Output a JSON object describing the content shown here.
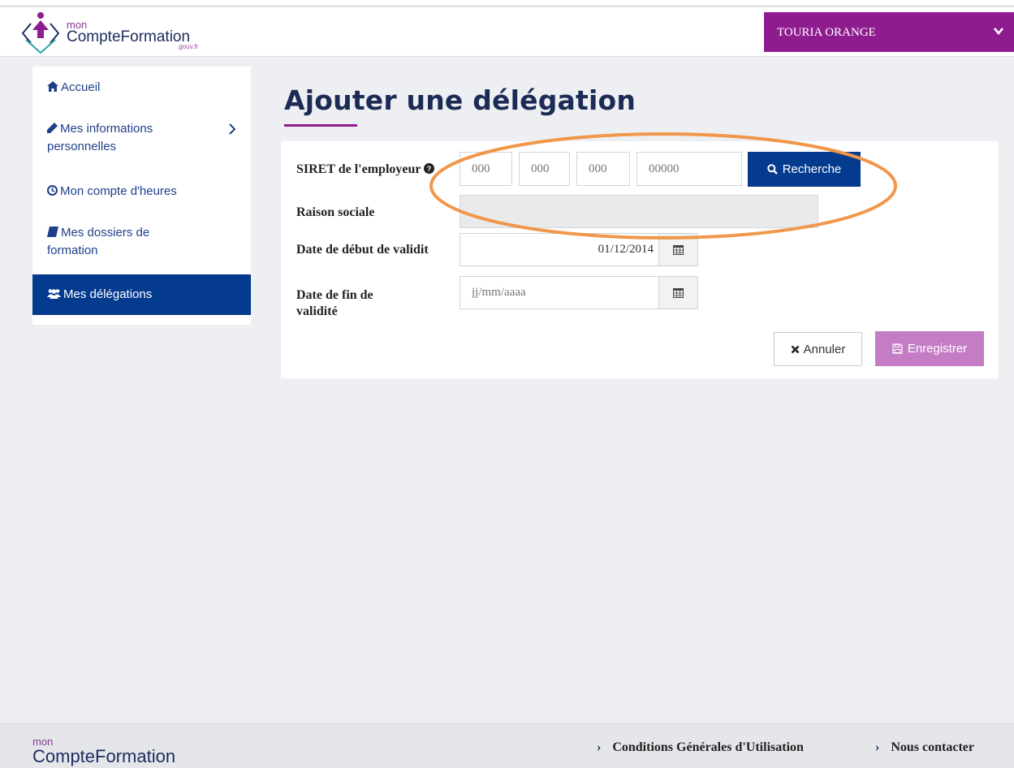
{
  "header": {
    "logo_mon": "mon",
    "logo_name": "CompteFormation",
    "logo_suffix": ".gouv.fr",
    "user_name": "TOURIA ORANGE"
  },
  "sidebar": {
    "items": [
      {
        "label": "Accueil",
        "icon": "home-icon"
      },
      {
        "label": "Mes informations",
        "label2": "personnelles",
        "icon": "pencil-icon",
        "has_chevron": true
      },
      {
        "label": "Mon compte d'heures",
        "icon": "clock-icon"
      },
      {
        "label": "Mes dossiers de",
        "label2": "formation",
        "icon": "book-icon"
      },
      {
        "label": "Mes délégations",
        "icon": "users-icon",
        "active": true
      }
    ]
  },
  "page": {
    "title": "Ajouter une délégation"
  },
  "form": {
    "siret_label": "SIRET de l'employeur",
    "siret_placeholders": [
      "000",
      "000",
      "000",
      "00000"
    ],
    "search_label": "Recherche",
    "raison_label": "Raison sociale",
    "raison_value": "",
    "start_label": "Date de début de validit",
    "start_value": "01/12/2014",
    "end_label_line1": "Date de fin de",
    "end_label_line2": "validité",
    "end_placeholder": "jj/mm/aaaa",
    "cancel_label": "Annuler",
    "save_label": "Enregistrer"
  },
  "footer": {
    "logo_mon": "mon",
    "logo_name": "CompteFormation",
    "cgu_label": "Conditions Générales d'Utilisation",
    "contact_label": "Nous contacter"
  },
  "colors": {
    "brand_purple": "#8e1c8f",
    "brand_navy": "#043b8f",
    "save_disabled": "#c47dc4",
    "highlight_orange": "#f0974a"
  }
}
